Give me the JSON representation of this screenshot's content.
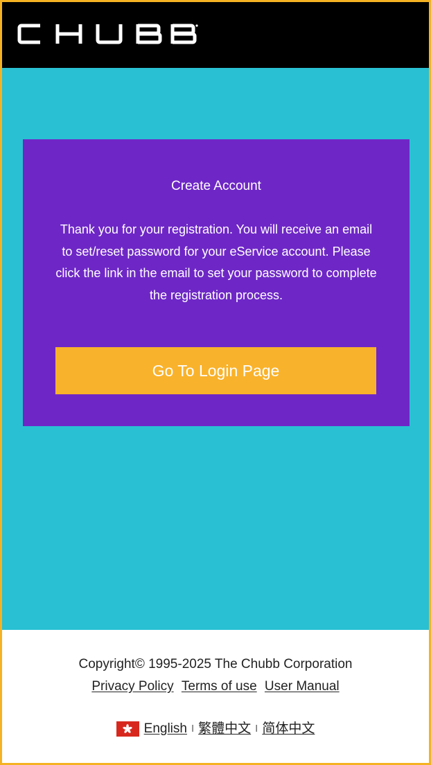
{
  "header": {
    "brand": "CHUBB"
  },
  "card": {
    "title": "Create Account",
    "message": "Thank you for your registration. You will receive an email to set/reset password for your eService account. Please click the link in the email to set your password to complete the registration process.",
    "button_label": "Go To Login Page"
  },
  "footer": {
    "copyright": "Copyright© 1995-2025 The Chubb Corporation",
    "links": [
      "Privacy Policy",
      "Terms of use",
      "User Manual"
    ],
    "languages": [
      "English",
      "繁體中文",
      "简体中文"
    ],
    "separator": "I"
  },
  "colors": {
    "header_bg": "#000000",
    "page_bg": "#29c0d3",
    "card_bg": "#6e27c6",
    "button_bg": "#f9b22b",
    "outer_border": "#f5b324",
    "flag": "#d8281e"
  },
  "icons": {
    "flag": "hong-kong-flag-icon"
  }
}
